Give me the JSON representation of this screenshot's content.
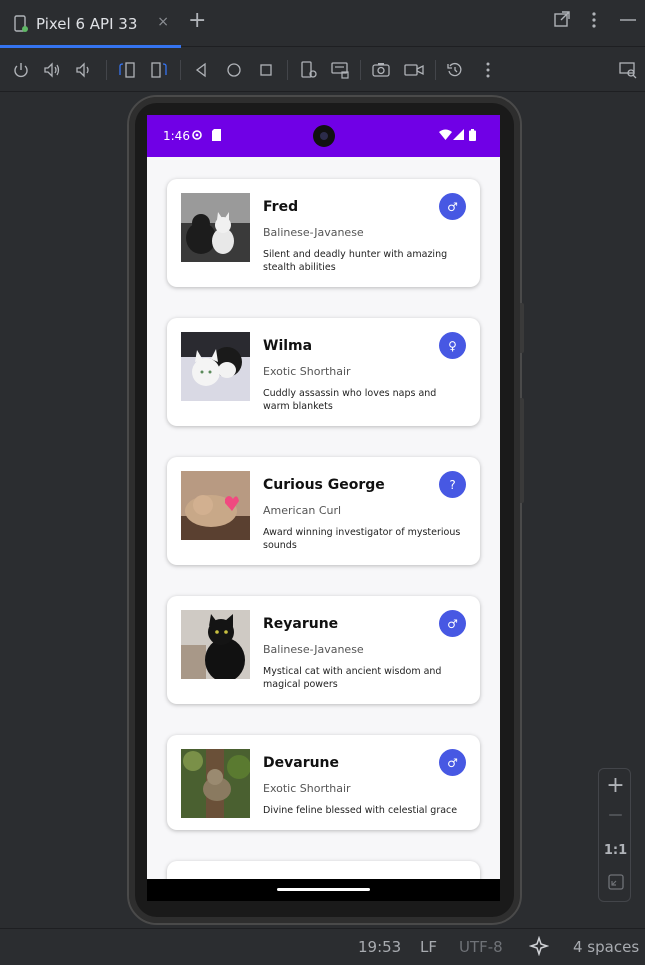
{
  "tabbar": {
    "tab_title": "Pixel 6 API 33",
    "close_glyph": "×",
    "add_glyph": "+",
    "accent": "#3574f0"
  },
  "toolbar": {
    "icons": [
      "power-icon",
      "volume-up-icon",
      "volume-down-icon",
      "rotate-left-icon",
      "rotate-right-icon",
      "back-icon",
      "home-icon",
      "overview-icon",
      "device-settings-icon",
      "keyboard-icon",
      "screenshot-icon",
      "screen-record-icon",
      "snapshot-icon",
      "more-icon",
      "device-mirror-icon"
    ]
  },
  "device": {
    "status_time": "1:46",
    "status_color": "#7000e6"
  },
  "cats": [
    {
      "name": "Fred",
      "breed": "Balinese-Javanese",
      "description": "Silent and deadly hunter with amazing stealth abilities",
      "gender": "♂"
    },
    {
      "name": "Wilma",
      "breed": "Exotic Shorthair",
      "description": "Cuddly assassin who loves naps and warm blankets",
      "gender": "♀"
    },
    {
      "name": "Curious George",
      "breed": "American Curl",
      "description": "Award winning investigator of mysterious sounds",
      "gender": "?"
    },
    {
      "name": "Reyarune",
      "breed": "Balinese-Javanese",
      "description": "Mystical cat with ancient wisdom and magical powers",
      "gender": "♂"
    },
    {
      "name": "Devarune",
      "breed": "Exotic Shorthair",
      "description": "Divine feline blessed with celestial grace",
      "gender": "♂"
    }
  ],
  "zoom": {
    "plus": "+",
    "minus": "—",
    "ratio": "1:1"
  },
  "status": {
    "time": "19:53",
    "line_sep": "LF",
    "encoding": "UTF-8",
    "indent": "4 spaces"
  }
}
